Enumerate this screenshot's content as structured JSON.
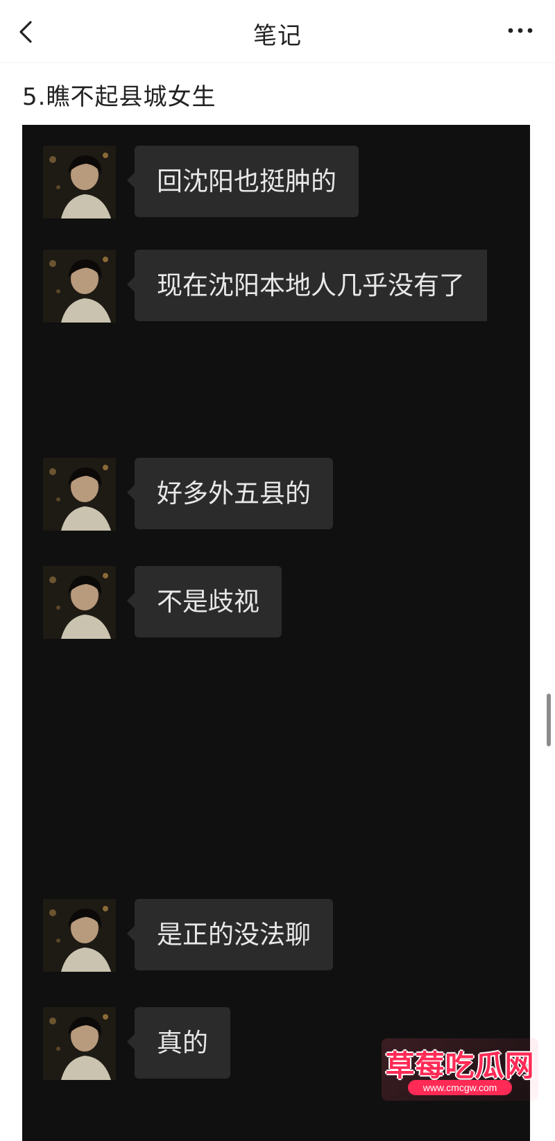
{
  "nav": {
    "title": "笔记",
    "back_icon": "chevron-left-icon",
    "more_icon": "more-horizontal-icon"
  },
  "note": {
    "title": "5.瞧不起县城女生"
  },
  "chat": {
    "messages": [
      {
        "text": "回沈阳也挺肿的"
      },
      {
        "text": "现在沈阳本地人几乎没有了"
      },
      {
        "text": "好多外五县的"
      },
      {
        "text": "不是歧视"
      },
      {
        "text": "是正的没法聊"
      },
      {
        "text": "真的"
      }
    ]
  },
  "watermark": {
    "main": "草莓吃瓜网",
    "url": "www.cmcgw.com"
  },
  "colors": {
    "chat_background": "#101010",
    "bubble": "#2b2b2b",
    "watermark_accent": "#ff2a55"
  }
}
